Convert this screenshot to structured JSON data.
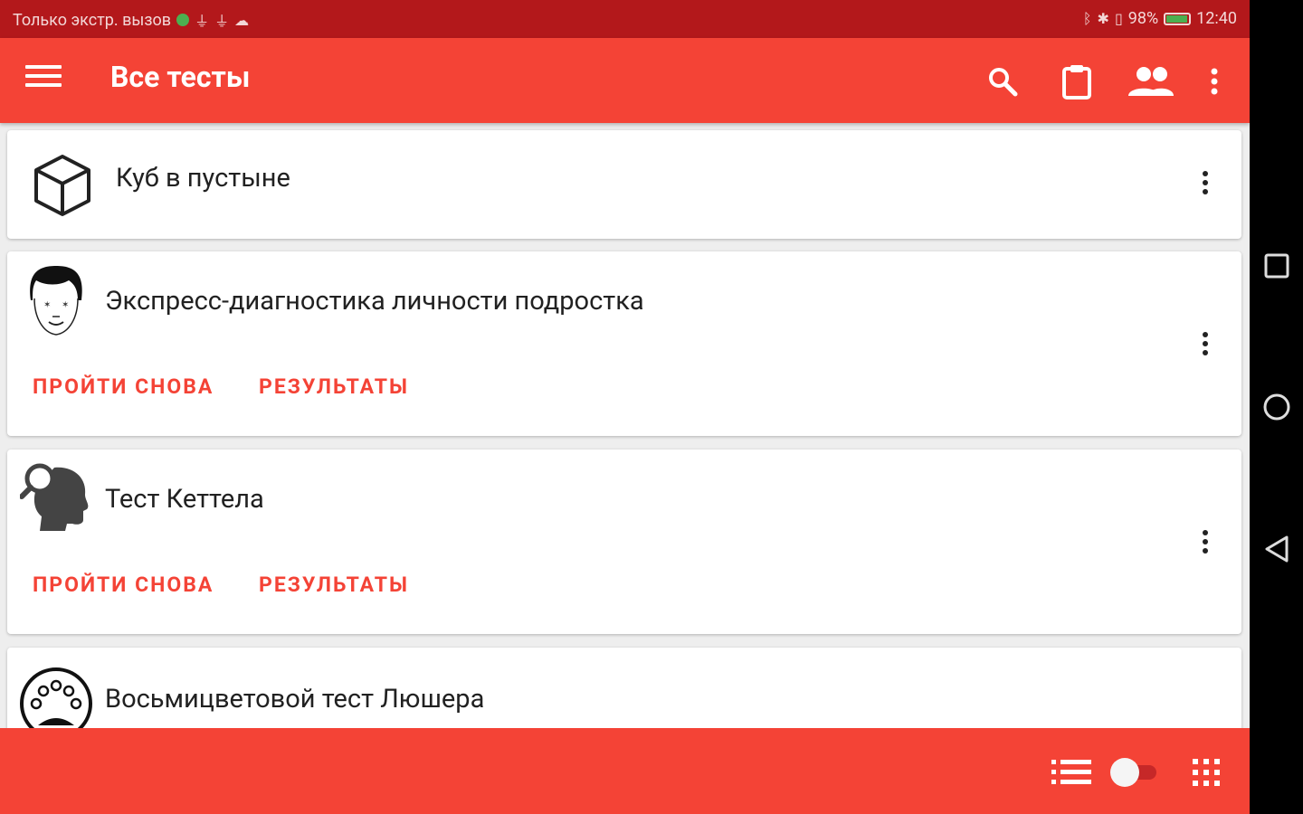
{
  "status_bar": {
    "carrier_text": "Только экстр. вызов",
    "battery_percent": "98%",
    "time": "12:40",
    "icons_left": [
      "globe-icon",
      "usb-icon",
      "usb-icon",
      "cloud-icon"
    ],
    "icons_right": [
      "bluetooth-icon",
      "vibrate-icon",
      "sim-icon",
      "battery-icon"
    ]
  },
  "toolbar": {
    "title": "Все тесты",
    "icons": [
      "menu-icon",
      "search-icon",
      "clipboard-icon",
      "people-icon",
      "more-vert-icon"
    ]
  },
  "tests": [
    {
      "title": "Куб в пустыне",
      "icon": "cube-icon",
      "actions": []
    },
    {
      "title": "Экспресс-диагностика личности подростка",
      "icon": "teen-face-icon",
      "actions": [
        "ПРОЙТИ СНОВА",
        "РЕЗУЛЬТАТЫ"
      ]
    },
    {
      "title": "Тест Кеттела",
      "icon": "head-magnifier-icon",
      "actions": [
        "ПРОЙТИ СНОВА",
        "РЕЗУЛЬТАТЫ"
      ]
    },
    {
      "title": "Восьмицветовой тест Люшера",
      "icon": "palette-icon",
      "actions": []
    }
  ],
  "bottom_bar": {
    "icons": [
      "list-view-icon",
      "view-toggle-switch",
      "grid-view-icon"
    ],
    "toggle_state": "list"
  },
  "nav_bar": {
    "icons": [
      "recents-icon",
      "home-icon",
      "back-icon"
    ]
  },
  "colors": {
    "primary": "#f44336",
    "status_bar": "#b3181b",
    "accent_text": "#f44336"
  }
}
